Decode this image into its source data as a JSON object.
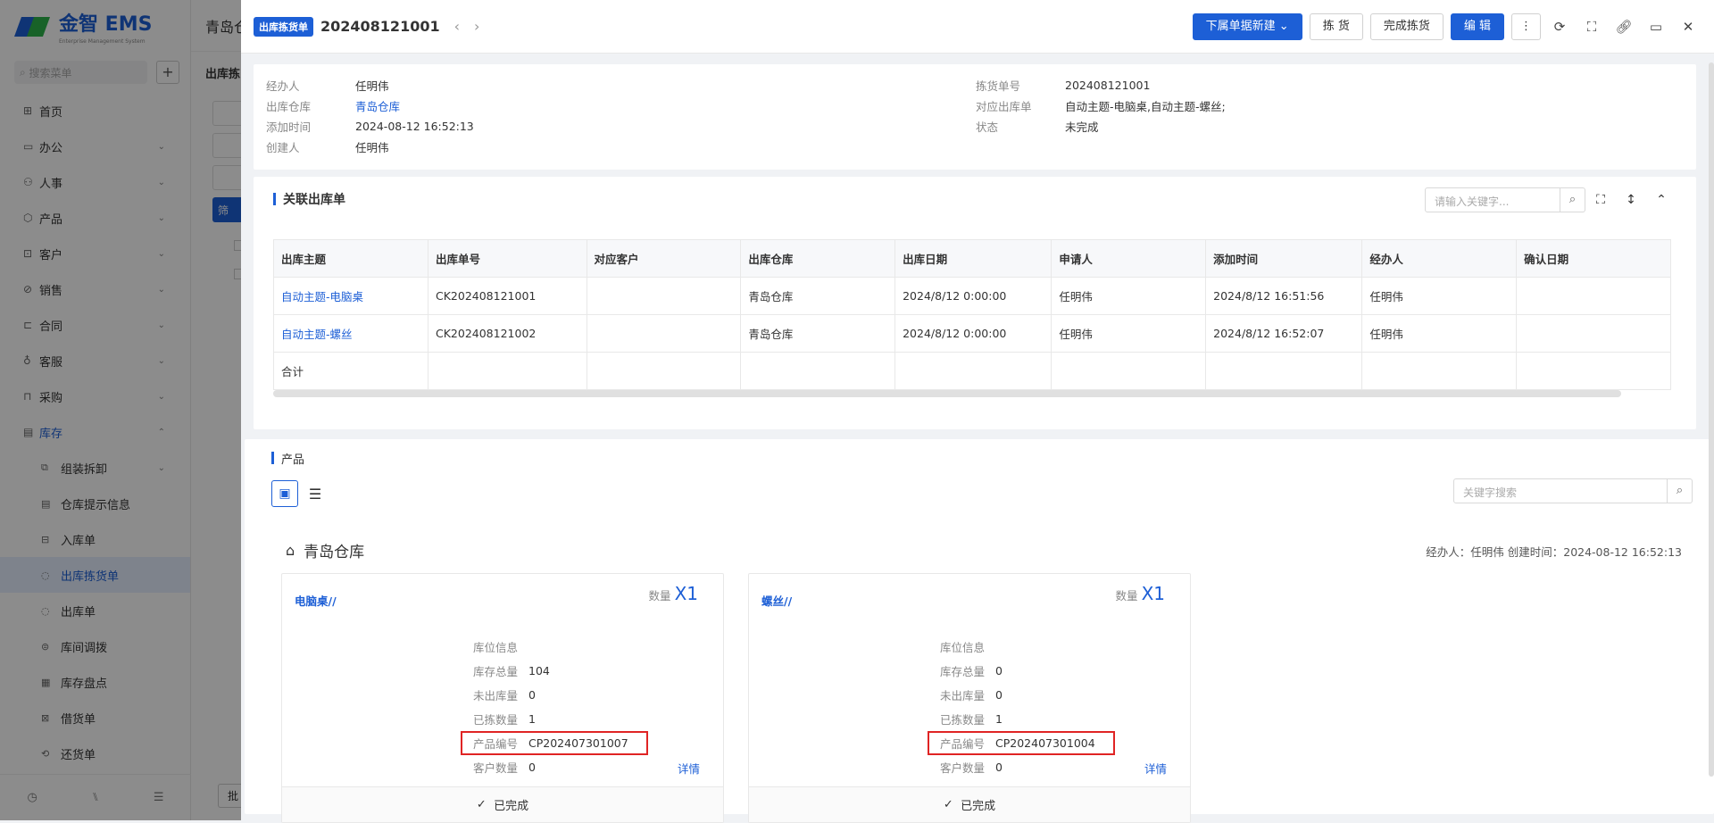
{
  "sidebar": {
    "logo_text": "金智 EMS",
    "logo_sub": "Enterprise Management System",
    "search_placeholder": "搜索菜单",
    "items": [
      {
        "label": "首页",
        "icon": "home-icon"
      },
      {
        "label": "办公",
        "icon": "office-icon"
      },
      {
        "label": "人事",
        "icon": "people-icon"
      },
      {
        "label": "产品",
        "icon": "box-icon"
      },
      {
        "label": "客户",
        "icon": "customer-icon"
      },
      {
        "label": "销售",
        "icon": "sales-icon"
      },
      {
        "label": "合同",
        "icon": "contract-icon"
      },
      {
        "label": "客服",
        "icon": "service-icon"
      },
      {
        "label": "采购",
        "icon": "purchase-icon"
      },
      {
        "label": "库存",
        "icon": "inventory-icon"
      }
    ],
    "sub_items": [
      {
        "label": "组装拆卸"
      },
      {
        "label": "仓库提示信息"
      },
      {
        "label": "入库单"
      },
      {
        "label": "出库拣货单"
      },
      {
        "label": "出库单"
      },
      {
        "label": "库间调拨"
      },
      {
        "label": "库存盘点"
      },
      {
        "label": "借货单"
      },
      {
        "label": "还货单"
      }
    ]
  },
  "background": {
    "top_title": "青岛仓",
    "section_title": "出库拣",
    "filter_btn": "筛",
    "footer_btn": "批"
  },
  "drawer": {
    "badge": "出库拣货单",
    "title": "202408121001",
    "buttons": {
      "new_sub": "下属单据新建",
      "pick": "拣 货",
      "finish": "完成拣货",
      "edit": "编 辑"
    },
    "info": {
      "handler_label": "经办人",
      "handler": "任明伟",
      "warehouse_label": "出库仓库",
      "warehouse": "青岛仓库",
      "added_label": "添加时间",
      "added": "2024-08-12 16:52:13",
      "creator_label": "创建人",
      "creator": "任明伟",
      "pick_no_label": "拣货单号",
      "pick_no": "202408121001",
      "out_order_label": "对应出库单",
      "out_order": "自动主题-电脑桌,自动主题-螺丝;",
      "status_label": "状态",
      "status": "未完成"
    },
    "related": {
      "title": "关联出库单",
      "search_placeholder": "请输入关键字...",
      "columns": [
        "出库主题",
        "出库单号",
        "对应客户",
        "出库仓库",
        "出库日期",
        "申请人",
        "添加时间",
        "经办人",
        "确认日期"
      ],
      "rows": [
        [
          "自动主题-电脑桌",
          "CK202408121001",
          "",
          "青岛仓库",
          "2024/8/12 0:00:00",
          "任明伟",
          "2024/8/12 16:51:56",
          "任明伟",
          ""
        ],
        [
          "自动主题-螺丝",
          "CK202408121002",
          "",
          "青岛仓库",
          "2024/8/12 0:00:00",
          "任明伟",
          "2024/8/12 16:52:07",
          "任明伟",
          ""
        ]
      ],
      "total_label": "合计"
    },
    "products": {
      "title": "产品",
      "search_placeholder": "关键字搜索",
      "warehouse": "青岛仓库",
      "meta": "经办人：任明伟    创建时间：2024-08-12 16:52:13",
      "cards": [
        {
          "name": "电脑桌//",
          "qty_label": "数量",
          "qty": "X1",
          "loc_label": "库位信息",
          "stock_label": "库存总量",
          "stock": "104",
          "unout_label": "未出库量",
          "unout": "0",
          "picked_label": "已拣数量",
          "picked": "1",
          "code_label": "产品编号",
          "code": "CP202407301007",
          "cust_label": "客户数量",
          "cust": "0",
          "detail": "详情",
          "status": "已完成"
        },
        {
          "name": "螺丝//",
          "qty_label": "数量",
          "qty": "X1",
          "loc_label": "库位信息",
          "stock_label": "库存总量",
          "stock": "0",
          "unout_label": "未出库量",
          "unout": "0",
          "picked_label": "已拣数量",
          "picked": "1",
          "code_label": "产品编号",
          "code": "CP202407301004",
          "cust_label": "客户数量",
          "cust": "0",
          "detail": "详情",
          "status": "已完成"
        }
      ]
    }
  }
}
